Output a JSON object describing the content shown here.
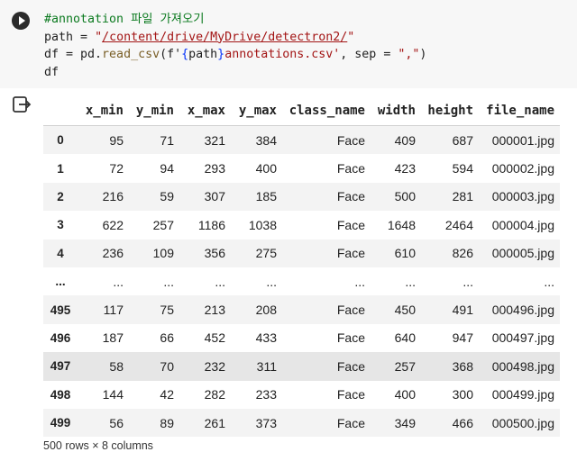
{
  "code": {
    "comment": "#annotation 파일 가져오기",
    "line2": {
      "var": "path",
      "op": " = ",
      "quote_open": "\"",
      "url": "/content/drive/MyDrive/detectron2/",
      "quote_close": "\""
    },
    "line3": {
      "prefix": "df = pd.",
      "fn": "read_csv",
      "open": "(f'",
      "b1": "{",
      "inner": "path",
      "b2": "}",
      "rest": "annotations.csv'",
      "sep": ", sep = ",
      "sepval": "\",\"",
      "close": ")"
    },
    "line4": "df"
  },
  "icons": {
    "run": "play-icon",
    "output": "output-menu-icon"
  },
  "table": {
    "columns": [
      "",
      "x_min",
      "y_min",
      "x_max",
      "y_max",
      "class_name",
      "width",
      "height",
      "file_name"
    ],
    "rows": [
      [
        "0",
        "95",
        "71",
        "321",
        "384",
        "Face",
        "409",
        "687",
        "000001.jpg"
      ],
      [
        "1",
        "72",
        "94",
        "293",
        "400",
        "Face",
        "423",
        "594",
        "000002.jpg"
      ],
      [
        "2",
        "216",
        "59",
        "307",
        "185",
        "Face",
        "500",
        "281",
        "000003.jpg"
      ],
      [
        "3",
        "622",
        "257",
        "1186",
        "1038",
        "Face",
        "1648",
        "2464",
        "000004.jpg"
      ],
      [
        "4",
        "236",
        "109",
        "356",
        "275",
        "Face",
        "610",
        "826",
        "000005.jpg"
      ],
      [
        "...",
        "...",
        "...",
        "...",
        "...",
        "...",
        "...",
        "...",
        "..."
      ],
      [
        "495",
        "117",
        "75",
        "213",
        "208",
        "Face",
        "450",
        "491",
        "000496.jpg"
      ],
      [
        "496",
        "187",
        "66",
        "452",
        "433",
        "Face",
        "640",
        "947",
        "000497.jpg"
      ],
      [
        "497",
        "58",
        "70",
        "232",
        "311",
        "Face",
        "257",
        "368",
        "000498.jpg"
      ],
      [
        "498",
        "144",
        "42",
        "282",
        "233",
        "Face",
        "400",
        "300",
        "000499.jpg"
      ],
      [
        "499",
        "56",
        "89",
        "261",
        "373",
        "Face",
        "349",
        "466",
        "000500.jpg"
      ]
    ]
  },
  "shape_text": "500 rows × 8 columns"
}
